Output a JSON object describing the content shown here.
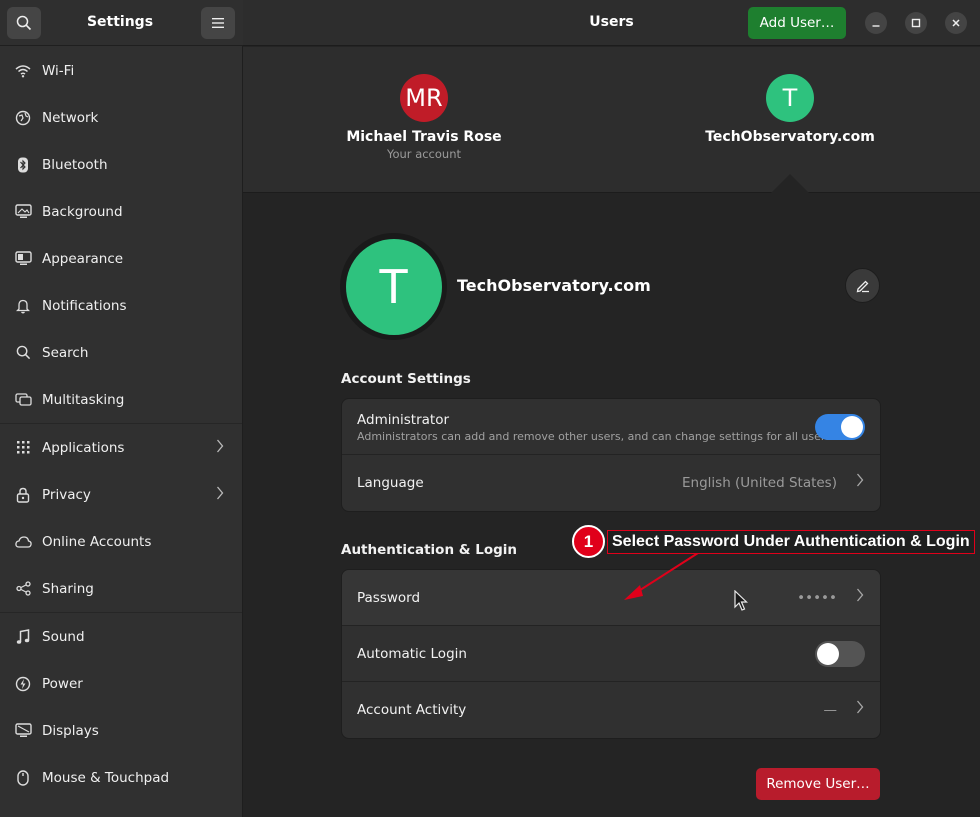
{
  "sidebar": {
    "title": "Settings",
    "items": [
      {
        "label": "Wi-Fi",
        "icon": "wifi-icon"
      },
      {
        "label": "Network",
        "icon": "network-icon"
      },
      {
        "label": "Bluetooth",
        "icon": "bluetooth-icon"
      },
      {
        "label": "Background",
        "icon": "background-icon"
      },
      {
        "label": "Appearance",
        "icon": "appearance-icon"
      },
      {
        "label": "Notifications",
        "icon": "bell-icon"
      },
      {
        "label": "Search",
        "icon": "search-icon"
      },
      {
        "label": "Multitasking",
        "icon": "multitasking-icon"
      },
      {
        "label": "Applications",
        "icon": "grid-icon"
      },
      {
        "label": "Privacy",
        "icon": "lock-icon"
      },
      {
        "label": "Online Accounts",
        "icon": "cloud-icon"
      },
      {
        "label": "Sharing",
        "icon": "share-icon"
      },
      {
        "label": "Sound",
        "icon": "music-note-icon"
      },
      {
        "label": "Power",
        "icon": "power-icon"
      },
      {
        "label": "Displays",
        "icon": "display-icon"
      },
      {
        "label": "Mouse & Touchpad",
        "icon": "mouse-icon"
      }
    ]
  },
  "header": {
    "title": "Users",
    "add_user_label": "Add User…"
  },
  "users": {
    "current": {
      "initials": "MR",
      "name": "Michael Travis Rose",
      "subtitle": "Your account",
      "color": "#c01c28"
    },
    "other": {
      "initials": "T",
      "name": "TechObservatory.com",
      "color": "#2ec27e"
    }
  },
  "selected_user": {
    "initial": "T",
    "name": "TechObservatory.com"
  },
  "account_settings": {
    "title": "Account Settings",
    "administrator": {
      "label": "Administrator",
      "description": "Administrators can add and remove other users, and can change settings for all users.",
      "enabled": true
    },
    "language": {
      "label": "Language",
      "value": "English (United States)"
    }
  },
  "auth": {
    "title": "Authentication & Login",
    "password": {
      "label": "Password",
      "value": "•••••"
    },
    "automatic_login": {
      "label": "Automatic Login",
      "enabled": false
    },
    "account_activity": {
      "label": "Account Activity",
      "value": "—"
    }
  },
  "remove_user_label": "Remove User…",
  "annotation": {
    "number": "1",
    "text": "Select Password Under Authentication & Login",
    "color": "#e0001a"
  },
  "colors": {
    "accent": "#3584e4",
    "add_button": "#1e7f2f",
    "destructive": "#b81c2c"
  }
}
